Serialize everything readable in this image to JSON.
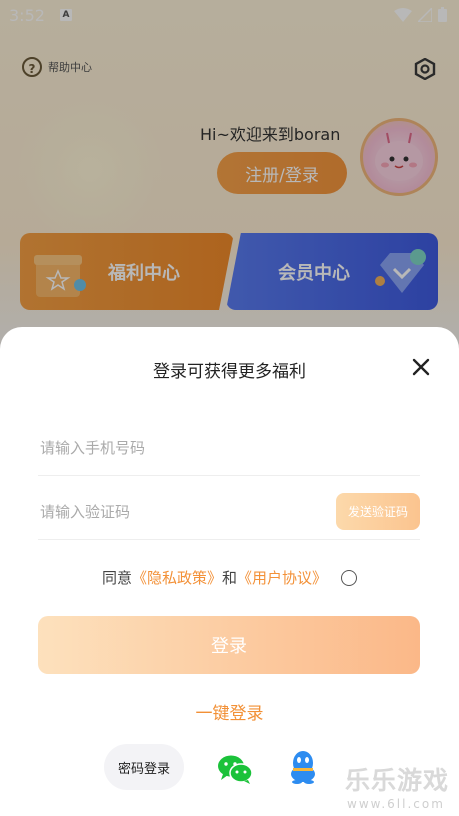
{
  "status_bar": {
    "time": "3:52",
    "notification_icon": "A"
  },
  "header": {
    "help_label": "帮助中心",
    "help_icon": "question-icon",
    "settings_icon": "hexagon-settings-icon"
  },
  "profile": {
    "greeting": "Hi~欢迎来到boran",
    "register_login_label": "注册/登录"
  },
  "cards": {
    "welfare_label": "福利中心",
    "vip_label": "会员中心"
  },
  "login_sheet": {
    "title": "登录可获得更多福利",
    "phone_placeholder": "请输入手机号码",
    "code_placeholder": "请输入验证码",
    "send_code_label": "发送验证码",
    "agree_prefix": "同意",
    "privacy_link": "《隐私政策》",
    "agree_and": "和",
    "user_agreement_link": "《用户协议》",
    "login_label": "登录",
    "one_key_login": "一键登录",
    "password_login": "密码登录"
  },
  "watermark": {
    "brand": "乐乐游戏",
    "url": "www.6ll.com"
  },
  "colors": {
    "accent_orange": "#f29036",
    "vip_blue": "#3f5be0",
    "login_button_gradient_end": "#fbb888"
  }
}
